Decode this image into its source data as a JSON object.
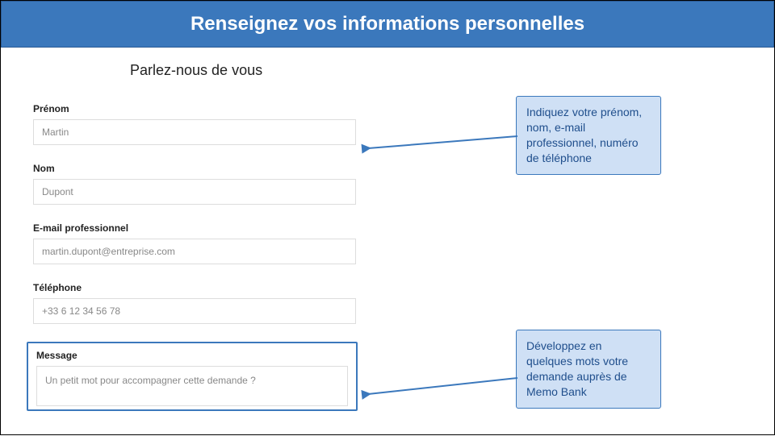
{
  "banner": {
    "title": "Renseignez vos informations personnelles"
  },
  "subheading": "Parlez-nous de vous",
  "form": {
    "prenom": {
      "label": "Prénom",
      "value": "Martin"
    },
    "nom": {
      "label": "Nom",
      "value": "Dupont"
    },
    "email": {
      "label": "E-mail professionnel",
      "value": "martin.dupont@entreprise.com"
    },
    "telephone": {
      "label": "Téléphone",
      "value": "+33 6 12 34 56 78"
    },
    "message": {
      "label": "Message",
      "placeholder": "Un petit mot pour accompagner cette demande ?"
    }
  },
  "callouts": {
    "top": "Indiquez votre prénom, nom, e-mail professionnel, numéro de téléphone",
    "bottom": "Développez en quelques mots votre demande auprès de Memo Bank"
  },
  "colors": {
    "accent": "#3b78bc",
    "callout_bg": "#cfe0f5",
    "callout_text": "#1f4e8c"
  }
}
